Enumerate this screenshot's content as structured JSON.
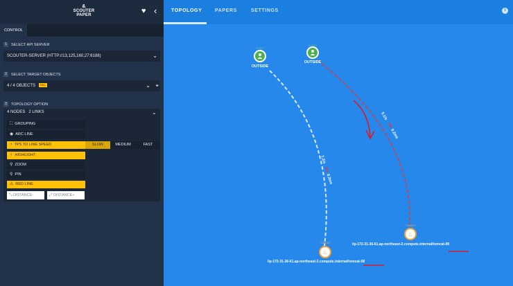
{
  "sidebar": {
    "logo_line1": "&",
    "logo_line2": "SCOUTER",
    "logo_line3": "PAPER",
    "heart_icon": "♥",
    "collapse_icon": "‹",
    "tab_control": "CONTROL",
    "section1": {
      "num": "1",
      "title": "SELECT API SERVER",
      "value": "SCOUTER-SERVER (HTTP://13,125,160,27:6188)"
    },
    "section2": {
      "num": "2",
      "title": "SELECT TARGET OBJECTS",
      "value": "4 / 4 OBJECTS",
      "tag": "ALL"
    },
    "section3": {
      "num": "3",
      "title": "TOPOLOGY OPTION",
      "summary": "4 NODES   2 LINKS",
      "options": {
        "grouping": "GROUPING",
        "arc_line": "ARC LINE",
        "tps_speed": "TPS TO LINE SPEED",
        "highlight": "HIGHLIGHT",
        "zoom": "ZOOM",
        "pin": "PIN",
        "red_line": "RED LINE",
        "distance_minus": "DISTANCE-",
        "distance_plus": "DISTANCE+"
      },
      "speeds": {
        "slow": "SLOW",
        "medium": "MEDIUM",
        "fast": "FAST"
      }
    }
  },
  "topbar": {
    "tabs": {
      "topology": "TOPOLOGY",
      "papers": "PAPERS",
      "settings": "SETTINGS"
    },
    "info_icon": "i"
  },
  "topology": {
    "nodes": {
      "client1": {
        "tag": "CLIENT",
        "label": "OUTSIDE"
      },
      "client2": {
        "tag": "CLIENT",
        "label": "OUTSIDE"
      },
      "tomcat08": {
        "tag": "TOMCAT",
        "label": "/ip-172-31-36-61.ap-northeast-2.compute.internal/tomcat-08"
      },
      "tomcat09": {
        "tag": "TOMCAT",
        "label": "/ip-172-31-36-61.ap-northeast-2.compute.internal/tomcat-09"
      }
    },
    "links": {
      "link1": {
        "tps": "7.2/s",
        "err": "0%",
        "time": "0.2ms"
      },
      "link2": {
        "tps": "5.1/s",
        "err": "0%",
        "time": "0.2ms"
      }
    }
  },
  "colors": {
    "accent": "#1b7fe0",
    "canvas": "#2588ea",
    "highlight_yellow": "#ffc107",
    "client_green": "#4caf50",
    "tomcat_orange": "#f39c3c",
    "red_line": "#e53935",
    "annotation_red": "#d81b2c"
  }
}
